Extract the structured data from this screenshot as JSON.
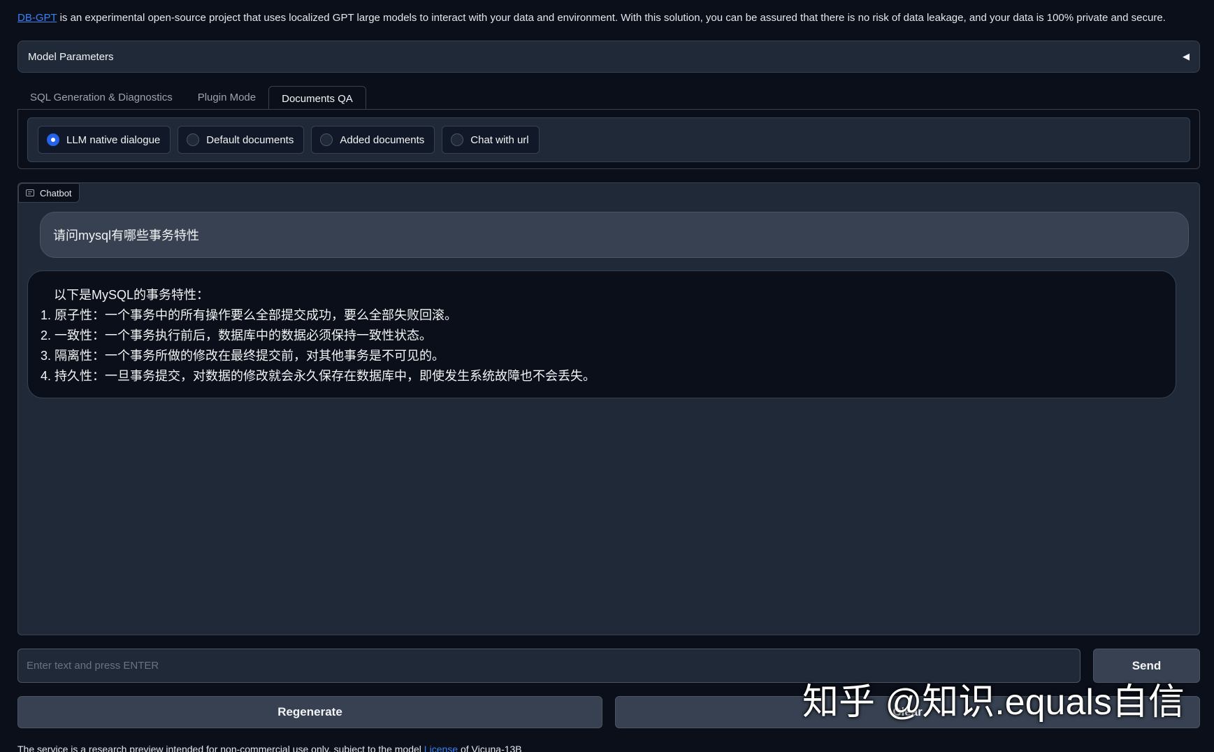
{
  "intro": {
    "link_text": "DB-GPT",
    "text": " is an experimental open-source project that uses localized GPT large models to interact with your data and environment. With this solution, you can be assured that there is no risk of data leakage, and your data is 100% private and secure."
  },
  "accordion": {
    "label": "Model Parameters",
    "toggle_icon": "◀"
  },
  "tabs": [
    {
      "label": "SQL Generation & Diagnostics",
      "active": false
    },
    {
      "label": "Plugin Mode",
      "active": false
    },
    {
      "label": "Documents QA",
      "active": true
    }
  ],
  "radio_options": [
    {
      "label": "LLM native dialogue",
      "selected": true
    },
    {
      "label": "Default documents",
      "selected": false
    },
    {
      "label": "Added documents",
      "selected": false
    },
    {
      "label": "Chat with url",
      "selected": false
    }
  ],
  "chatbot": {
    "label": "Chatbot",
    "user_message": "请问mysql有哪些事务特性",
    "bot_intro": "以下是MySQL的事务特性：",
    "bot_items": [
      "1. 原子性：一个事务中的所有操作要么全部提交成功，要么全部失败回滚。",
      "2. 一致性：一个事务执行前后，数据库中的数据必须保持一致性状态。",
      "3. 隔离性：一个事务所做的修改在最终提交前，对其他事务是不可见的。",
      "4. 持久性：一旦事务提交，对数据的修改就会永久保存在数据库中，即使发生系统故障也不会丢失。"
    ]
  },
  "input": {
    "placeholder": "Enter text and press ENTER",
    "value": ""
  },
  "buttons": {
    "send": "Send",
    "regenerate": "Regenerate",
    "clear": "Clear"
  },
  "watermark": "知乎 @知识.equals自信",
  "footer": {
    "text_before": "The service is a research preview intended for non-commercial use only, subject to the model ",
    "link_text": "License",
    "text_after": " of Vicuna-13B"
  },
  "colors": {
    "background": "#0b0f19",
    "panel": "#1f2937",
    "border": "#374151",
    "accent": "#2563eb",
    "link": "#3b82f6"
  }
}
